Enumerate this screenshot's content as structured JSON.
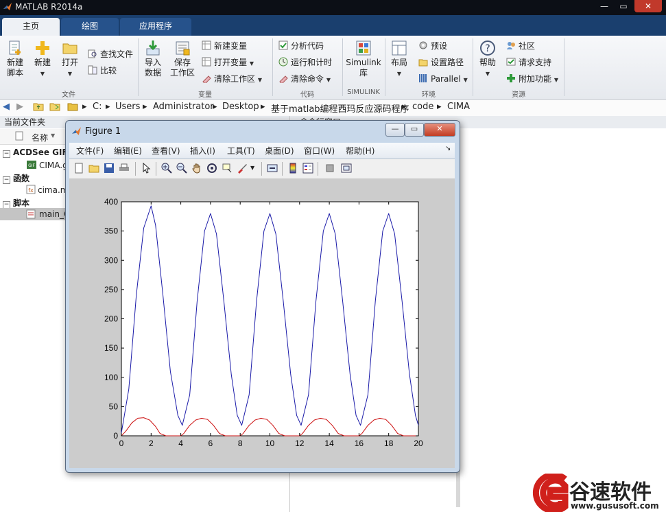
{
  "app": {
    "title": "MATLAB R2014a"
  },
  "window_controls": {
    "minimize": "—",
    "maximize": "▭",
    "close": "✕"
  },
  "tabs": [
    {
      "label": "主页"
    },
    {
      "label": "绘图"
    },
    {
      "label": "应用程序"
    }
  ],
  "ribbon": {
    "file": {
      "group_label": "文件",
      "new_script": "新建\n脚本",
      "new_script_l1": "新建",
      "new_script_l2": "脚本",
      "new": "新建",
      "open": "打开",
      "find_files": "查找文件",
      "compare": "比较"
    },
    "variable": {
      "group_label": "变量",
      "import_l1": "导入",
      "import_l2": "数据",
      "save_l1": "保存",
      "save_l2": "工作区",
      "new_variable": "新建变量",
      "open_variable": "打开变量",
      "clear_workspace": "清除工作区"
    },
    "code": {
      "group_label": "代码",
      "analyze": "分析代码",
      "run_time": "运行和计时",
      "clear_commands": "清除命令"
    },
    "simulink": {
      "group_label": "SIMULINK",
      "library_l1": "Simulink",
      "library_l2": "库"
    },
    "environment": {
      "group_label": "环境",
      "layout": "布局",
      "preferences": "预设",
      "set_path": "设置路径",
      "parallel": "Parallel"
    },
    "resources": {
      "group_label": "资源",
      "help": "帮助",
      "community": "社区",
      "support": "请求支持",
      "addons": "附加功能"
    }
  },
  "address": {
    "segments": [
      "C:",
      "Users",
      "Administrator",
      "Desktop",
      "基于matlab编程西玛反应源码程序",
      "code",
      "CIMA"
    ]
  },
  "left_panel": {
    "title": "当前文件夹",
    "column_name": "名称",
    "groups": [
      {
        "label": "ACDSee GIF",
        "item": "CIMA.gif"
      },
      {
        "label": "函数",
        "item": "cima.m"
      },
      {
        "label": "脚本",
        "item": "main_C"
      }
    ]
  },
  "right_panel": {
    "title": "命令行窗口"
  },
  "figure": {
    "title": "Figure 1",
    "menus": [
      "文件(F)",
      "编辑(E)",
      "查看(V)",
      "插入(I)",
      "工具(T)",
      "桌面(D)",
      "窗口(W)",
      "帮助(H)"
    ],
    "toolbar_icons": [
      "new-figure-icon",
      "open-file-icon",
      "save-icon",
      "print-icon",
      "pointer-icon",
      "zoom-in-icon",
      "zoom-out-icon",
      "pan-icon",
      "rotate-icon",
      "data-cursor-icon",
      "brush-icon",
      "link-icon",
      "colorbar-icon",
      "legend-icon",
      "hide-plot-tools-icon",
      "show-plot-tools-icon"
    ]
  },
  "chart_data": {
    "type": "line",
    "title": "",
    "xlabel": "",
    "ylabel": "",
    "xlim": [
      0,
      20
    ],
    "ylim": [
      0,
      400
    ],
    "xticks": [
      0,
      2,
      4,
      6,
      8,
      10,
      12,
      14,
      16,
      18,
      20
    ],
    "yticks": [
      0,
      50,
      100,
      150,
      200,
      250,
      300,
      350,
      400
    ],
    "grid": false,
    "series": [
      {
        "color": "#1a1aa8",
        "x": [
          0,
          0.5,
          1.0,
          1.5,
          2.0,
          2.3,
          2.8,
          3.3,
          3.8,
          4.1,
          4.6,
          5.1,
          5.6,
          6.0,
          6.4,
          6.9,
          7.4,
          7.8,
          8.1,
          8.6,
          9.1,
          9.6,
          10.0,
          10.4,
          10.9,
          11.4,
          11.8,
          12.1,
          12.6,
          13.1,
          13.6,
          14.0,
          14.4,
          14.9,
          15.4,
          15.8,
          16.1,
          16.6,
          17.1,
          17.6,
          18.0,
          18.4,
          18.9,
          19.4,
          19.8,
          20.0
        ],
        "y": [
          5,
          80,
          240,
          355,
          393,
          360,
          240,
          110,
          35,
          18,
          70,
          230,
          350,
          380,
          345,
          230,
          105,
          35,
          18,
          70,
          230,
          350,
          380,
          345,
          230,
          105,
          35,
          18,
          70,
          230,
          350,
          380,
          345,
          230,
          105,
          35,
          18,
          70,
          230,
          350,
          380,
          345,
          230,
          105,
          35,
          18
        ]
      },
      {
        "color": "#cc1010",
        "x": [
          0,
          0.3,
          0.7,
          1.1,
          1.5,
          1.9,
          2.3,
          2.6,
          3.0,
          4.0,
          4.2,
          4.6,
          5.0,
          5.4,
          5.8,
          6.2,
          6.6,
          7.0,
          8.0,
          8.2,
          8.6,
          9.0,
          9.4,
          9.8,
          10.2,
          10.6,
          11.0,
          12.0,
          12.2,
          12.6,
          13.0,
          13.4,
          13.8,
          14.2,
          14.6,
          15.0,
          16.0,
          16.2,
          16.6,
          17.0,
          17.4,
          17.8,
          18.2,
          18.6,
          19.0,
          20.0
        ],
        "y": [
          0,
          8,
          22,
          30,
          31,
          27,
          16,
          4,
          0,
          0,
          4,
          18,
          27,
          30,
          28,
          18,
          4,
          0,
          0,
          4,
          18,
          27,
          30,
          28,
          18,
          4,
          0,
          0,
          4,
          18,
          27,
          30,
          28,
          18,
          4,
          0,
          0,
          4,
          18,
          27,
          30,
          28,
          18,
          4,
          0,
          0
        ]
      }
    ]
  },
  "watermark": {
    "brand": "谷速软件",
    "url": "www.gususoft.com",
    "color": "#d0201b"
  }
}
